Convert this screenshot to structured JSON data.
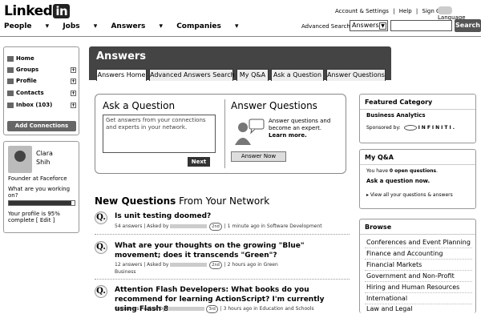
{
  "header": {
    "logo_text": "Linked",
    "logo_in": "in",
    "top_links": [
      "Account & Settings",
      "|",
      "Help",
      "|",
      "Sign Out"
    ],
    "language": "Language",
    "nav": [
      "People",
      "Jobs",
      "Answers",
      "Companies"
    ],
    "advanced_search": "Advanced Search",
    "search_select": "Answers",
    "search_button": "Search"
  },
  "left": {
    "items": [
      {
        "label": "Home"
      },
      {
        "label": "Groups"
      },
      {
        "label": "Profile"
      },
      {
        "label": "Contacts"
      },
      {
        "label": "Inbox (103)"
      }
    ],
    "add_connections": "Add Connections"
  },
  "profile": {
    "first": "Clara",
    "last": "Shih",
    "headline": "Founder at Faceforce",
    "prompt": "What are you working on?",
    "complete_line1": "Your profile is 95%",
    "complete_line2": "complete [ Edit ]",
    "progress": 0.95
  },
  "main": {
    "title": "Answers",
    "tabs": [
      "Answers Home",
      "Advanced Answers Search",
      "My Q&A",
      "Ask a Question",
      "Answer Questions"
    ],
    "ask_title": "Ask a Question",
    "ask_placeholder": "Get answers from your connections and experts in your network.",
    "next": "Next",
    "answer_title": "Answer Questions",
    "answer_text1": "Answer questions and",
    "answer_text2": "become an expert.",
    "learn_more": "Learn more.",
    "answer_now": "Answer Now",
    "new_questions_bold": "New Questions",
    "new_questions_rest": "From Your Network",
    "questions": [
      {
        "title": "Is unit testing doomed?",
        "answers": "54 answers | Asked by",
        "degree": "2nd",
        "meta": "| 1 minute ago in Software Development",
        "meta2": ""
      },
      {
        "title": "What are your thoughts on the growing \"Blue\" movement; does it transcends \"Green\"?",
        "answers": "12 answers | Asked by",
        "degree": "2nd",
        "meta": "| 2 hours ago in Green",
        "meta2": "Business"
      },
      {
        "title": "Attention Flash Developers: What books do you recommend for learning ActionScript? I'm currently using Flash 8.",
        "answers": "0 answers | Asked by",
        "degree": "3rd",
        "meta": "| 3 hours ago in Education and Schools",
        "meta2": ""
      }
    ]
  },
  "right": {
    "featured_heading": "Featured Category",
    "featured_name": "Business Analytics",
    "sponsored": "Sponsored by:",
    "sponsor": "INFINITI.",
    "myqa_heading": "My Q&A",
    "myqa_open_pre": "You have",
    "myqa_open_bold": "0 open questions",
    "myqa_open_post": ".",
    "myqa_ask": "Ask a question now.",
    "myqa_view": "View all your questions & answers",
    "browse_heading": "Browse",
    "browse": [
      "Conferences and Event Planning",
      "Finance and Accounting",
      "Financial Markets",
      "Government and Non-Profit",
      "Hiring and Human Resources",
      "International",
      "Law and Legal"
    ]
  }
}
